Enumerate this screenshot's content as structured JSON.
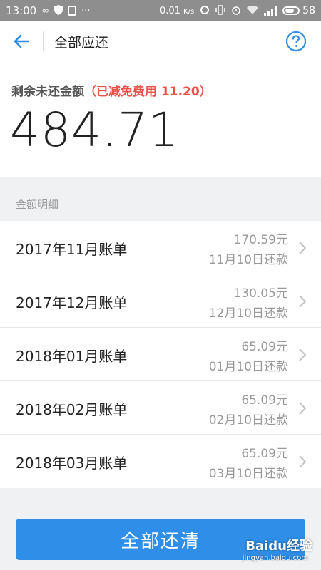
{
  "statusbar": {
    "time": "13:00",
    "speed": "0.01",
    "speed_unit": "K/s",
    "battery": "58"
  },
  "header": {
    "title": "全部应还",
    "back_icon": "back-arrow-icon",
    "help_icon": "question-icon"
  },
  "summary": {
    "label": "剩余未还金额",
    "discount_prefix": "（",
    "discount": "已减免费用 11.20",
    "discount_suffix": "）",
    "amount": "484.71"
  },
  "section_label": "金额明细",
  "bills": [
    {
      "name": "2017年11月账单",
      "amount": "170.59元",
      "due": "11月10日还款"
    },
    {
      "name": "2017年12月账单",
      "amount": "130.05元",
      "due": "12月10日还款"
    },
    {
      "name": "2018年01月账单",
      "amount": "65.09元",
      "due": "01月10日还款"
    },
    {
      "name": "2018年02月账单",
      "amount": "65.09元",
      "due": "02月10日还款"
    },
    {
      "name": "2018年03月账单",
      "amount": "65.09元",
      "due": "03月10日还款"
    }
  ],
  "pay_button": "全部还清",
  "watermark": "Baidu经验",
  "watermark_sub": "jingyan.baidu.com",
  "colors": {
    "accent": "#2f8ee8",
    "discount_red": "#e8514a",
    "statusbar": "#8e8e8e"
  }
}
